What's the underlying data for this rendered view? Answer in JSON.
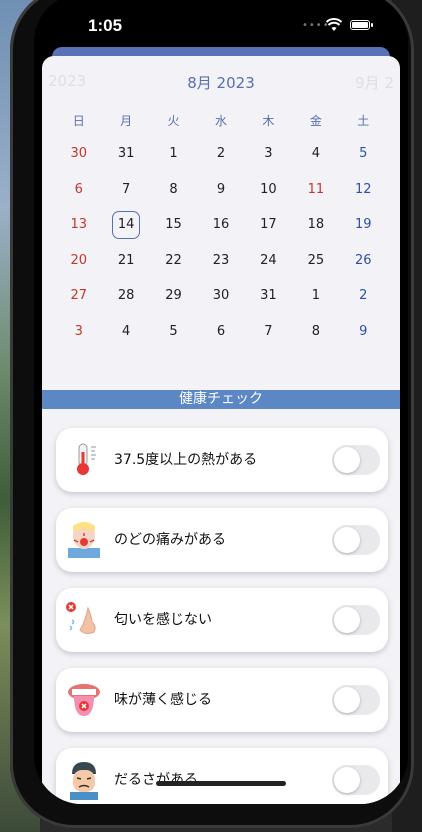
{
  "status": {
    "time": "1:05"
  },
  "calendar": {
    "prev_month": "2023",
    "current_month": "8月 2023",
    "next_month": "9月 2",
    "weekdays": [
      "日",
      "月",
      "火",
      "水",
      "木",
      "金",
      "土"
    ],
    "weeks": [
      [
        "30",
        "31",
        "1",
        "2",
        "3",
        "4",
        "5"
      ],
      [
        "6",
        "7",
        "8",
        "9",
        "10",
        "11",
        "12"
      ],
      [
        "13",
        "14",
        "15",
        "16",
        "17",
        "18",
        "19"
      ],
      [
        "20",
        "21",
        "22",
        "23",
        "24",
        "25",
        "26"
      ],
      [
        "27",
        "28",
        "29",
        "30",
        "31",
        "1",
        "2"
      ],
      [
        "3",
        "4",
        "5",
        "6",
        "7",
        "8",
        "9"
      ]
    ],
    "selected_day": "14",
    "holiday_day": "11"
  },
  "section_title": "健康チェック",
  "checks": [
    {
      "label": "37.5度以上の熱がある",
      "icon": "thermometer-icon",
      "on": false
    },
    {
      "label": "のどの痛みがある",
      "icon": "sore-throat-icon",
      "on": false
    },
    {
      "label": "匂いを感じない",
      "icon": "nose-icon",
      "on": false
    },
    {
      "label": "味が薄く感じる",
      "icon": "tongue-icon",
      "on": false
    },
    {
      "label": "だるさがある",
      "icon": "tired-face-icon",
      "on": false
    }
  ],
  "colors": {
    "accent": "#5870b0",
    "section_bar": "#5b87c4",
    "sunday": "#c0392b",
    "saturday": "#2f4fa8"
  }
}
